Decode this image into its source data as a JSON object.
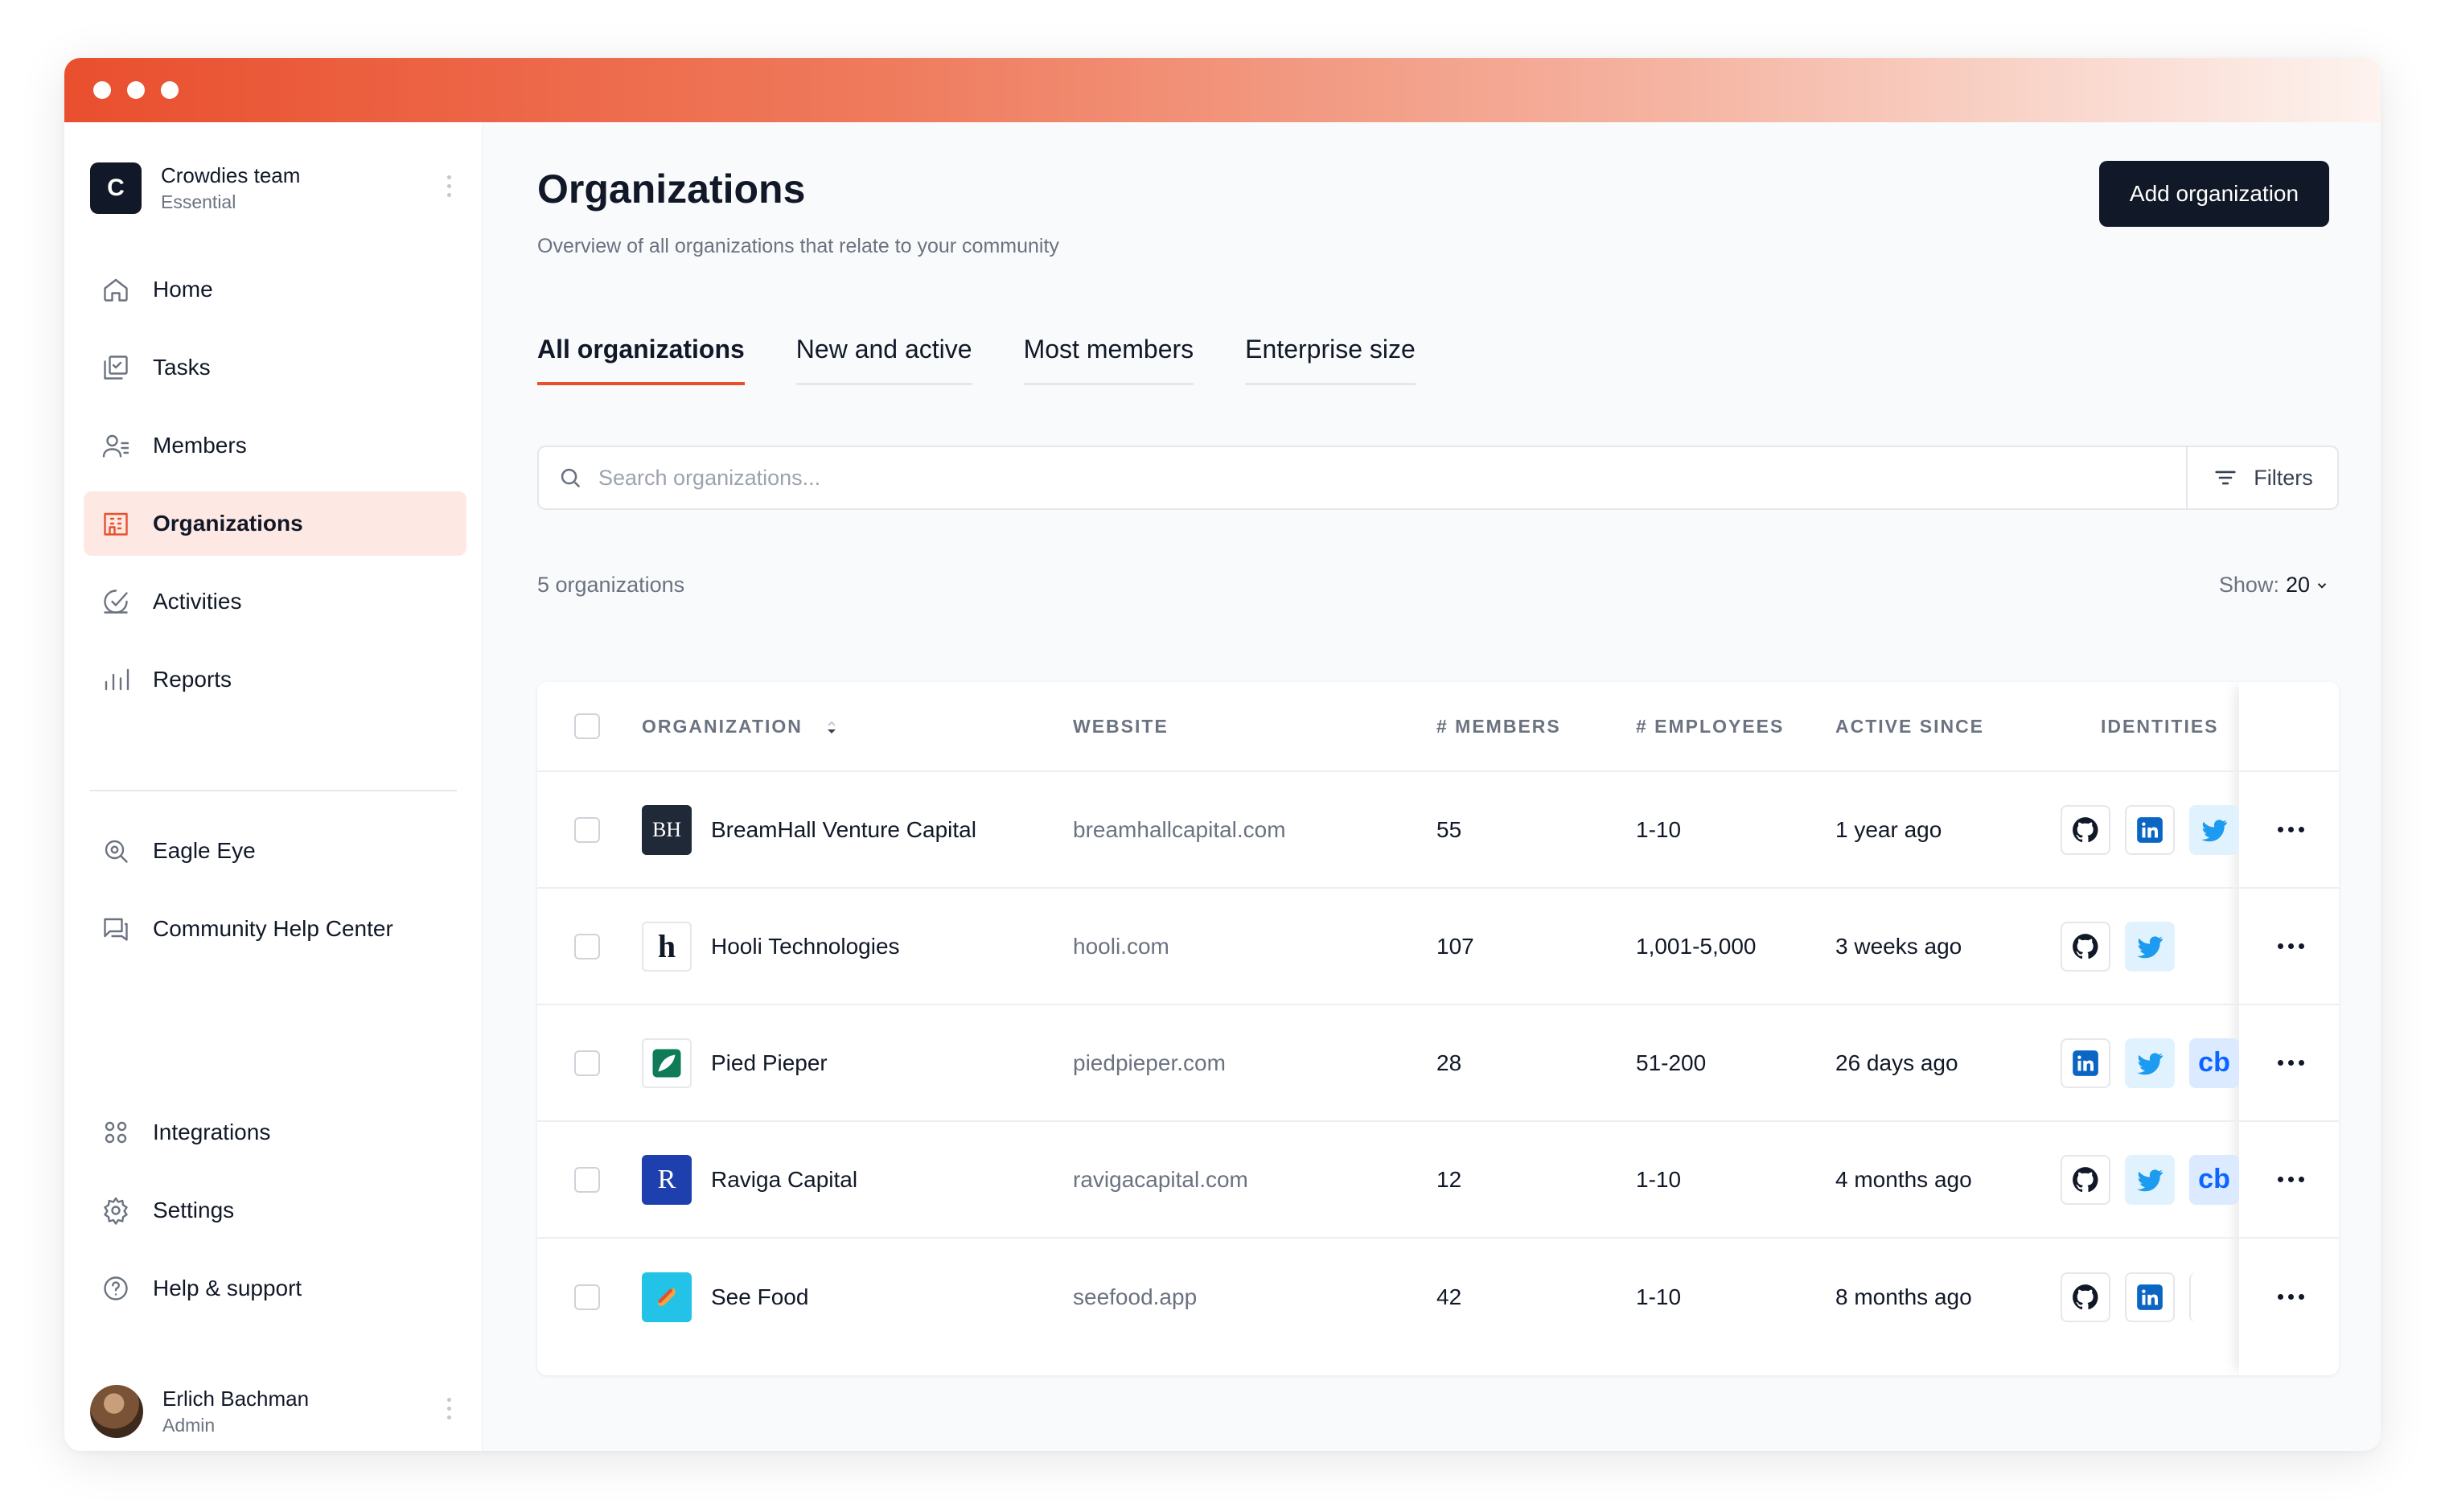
{
  "team": {
    "initial": "C",
    "name": "Crowdies team",
    "plan": "Essential"
  },
  "nav": {
    "home": "Home",
    "tasks": "Tasks",
    "members": "Members",
    "organizations": "Organizations",
    "activities": "Activities",
    "reports": "Reports",
    "eagle_eye": "Eagle Eye",
    "help_center": "Community Help Center",
    "integrations": "Integrations",
    "settings": "Settings",
    "help_support": "Help & support"
  },
  "user": {
    "name": "Erlich Bachman",
    "role": "Admin"
  },
  "page": {
    "title": "Organizations",
    "subtitle": "Overview of all organizations that relate to your community",
    "add_button": "Add organization"
  },
  "tabs": [
    "All organizations",
    "New and active",
    "Most members",
    "Enterprise size"
  ],
  "search": {
    "placeholder": "Search organizations...",
    "filters_label": "Filters"
  },
  "summary": {
    "count": "5 organizations",
    "show_label": "Show:",
    "show_value": "20"
  },
  "table": {
    "headers": [
      "ORGANIZATION",
      "WEBSITE",
      "# MEMBERS",
      "# EMPLOYEES",
      "ACTIVE SINCE",
      "IDENTITIES"
    ],
    "rows": [
      {
        "logo": "BH",
        "name": "BreamHall Venture Capital",
        "website": "breamhallcapital.com",
        "members": "55",
        "employees": "1-10",
        "active_since": "1 year ago",
        "identities": [
          "github",
          "linkedin",
          "twitter"
        ]
      },
      {
        "logo": "h",
        "name": "Hooli Technologies",
        "website": "hooli.com",
        "members": "107",
        "employees": "1,001-5,000",
        "active_since": "3 weeks ago",
        "identities": [
          "github",
          "twitter"
        ]
      },
      {
        "logo": "leaf",
        "name": "Pied Pieper",
        "website": "piedpieper.com",
        "members": "28",
        "employees": "51-200",
        "active_since": "26 days ago",
        "identities": [
          "linkedin",
          "twitter",
          "crunchbase"
        ]
      },
      {
        "logo": "R",
        "name": "Raviga Capital",
        "website": "ravigacapital.com",
        "members": "12",
        "employees": "1-10",
        "active_since": "4 months ago",
        "identities": [
          "github",
          "twitter",
          "crunchbase"
        ]
      },
      {
        "logo": "hotdog",
        "name": "See Food",
        "website": "seefood.app",
        "members": "42",
        "employees": "1-10",
        "active_since": "8 months ago",
        "identities": [
          "github",
          "linkedin",
          "more"
        ]
      }
    ],
    "crunchbase_text": "cb"
  },
  "colors": {
    "accent": "#e94f2e",
    "dark": "#111827",
    "muted": "#6b7280"
  }
}
